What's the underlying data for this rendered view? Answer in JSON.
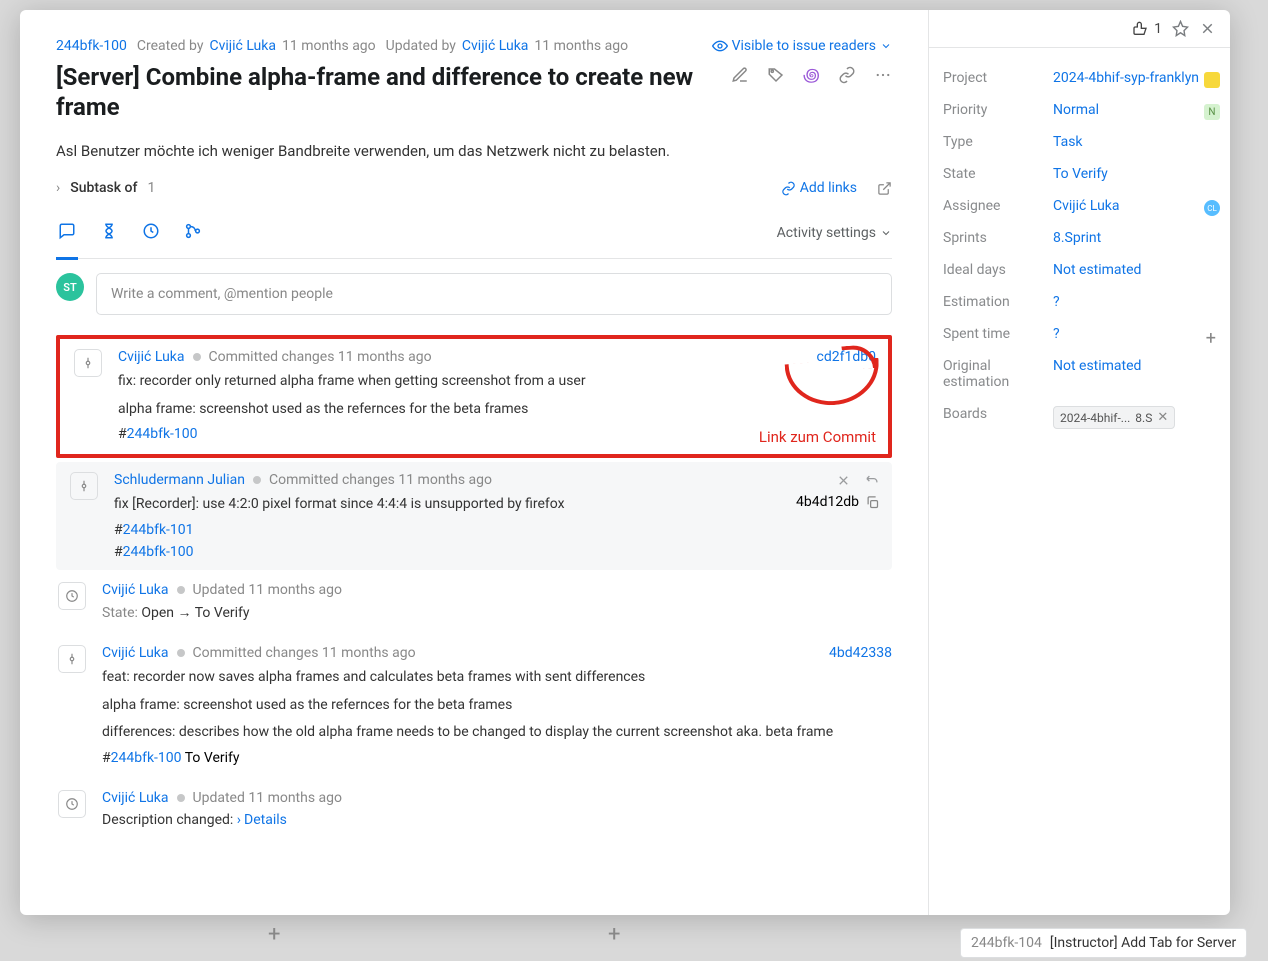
{
  "breadcrumb": {
    "issueId": "244bfk-100",
    "created": "Created by",
    "creator": "Cvijić Luka",
    "createdTime": "11 months ago",
    "updated": "Updated by",
    "updater": "Cvijić Luka",
    "updatedTime": "11 months ago",
    "visibility": "Visible to issue readers"
  },
  "title": "[Server] Combine alpha-frame and difference to create new frame",
  "description": "Asl Benutzer möchte ich weniger Bandbreite verwenden, um das Netzwerk nicht zu belasten.",
  "subtask": {
    "label": "Subtask of",
    "count": "1"
  },
  "addLinks": "Add links",
  "activitySettings": "Activity settings",
  "commentPlaceholder": "Write a comment, @mention people",
  "meAvatar": "ST",
  "annotation": "Link zum Commit",
  "voteCount": "1",
  "activities": [
    {
      "type": "commit",
      "authorText": "Cvijić Luka",
      "meta": "Committed changes 11 months ago",
      "commit": "cd2f1db0",
      "msgs": [
        "fix: recorder only returned alpha frame when getting screenshot from a user",
        "alpha frame: screenshot used as the refernces for the beta frames"
      ],
      "tags": [
        "244bfk-100"
      ]
    },
    {
      "type": "commit",
      "authorText": "Schludermann Julian",
      "meta": "Committed changes 11 months ago",
      "commit": "4b4d12db",
      "msgs": [
        "fix [Recorder]: use 4:2:0 pixel format since 4:4:4 is unsupported by firefox"
      ],
      "tags": [
        "244bfk-101",
        "244bfk-100"
      ],
      "hover": true
    },
    {
      "type": "state",
      "authorText": "Cvijić Luka",
      "meta": "Updated 11 months ago",
      "stateFrom": "Open",
      "stateTo": "To Verify"
    },
    {
      "type": "commit",
      "authorText": "Cvijić Luka",
      "meta": "Committed changes 11 months ago",
      "commit": "4bd42338",
      "msgs": [
        "feat: recorder now saves alpha frames and calculates beta frames with sent differences",
        "alpha frame: screenshot used as the refernces for the beta frames",
        "differences: describes how the old alpha frame needs to be changed to display the current screenshot aka. beta frame"
      ],
      "tags": [
        "244bfk-100"
      ],
      "suffix": "To Verify"
    },
    {
      "type": "desc",
      "authorText": "Cvijić Luka",
      "meta": "Updated 11 months ago",
      "descLabel": "Description changed:",
      "detailsLabel": "Details"
    }
  ],
  "side": {
    "fields": {
      "projectLabel": "Project",
      "projectVal": "2024-4bhif-syp-franklyn",
      "priorityLabel": "Priority",
      "priorityVal": "Normal",
      "typeLabel": "Type",
      "typeVal": "Task",
      "stateLabel": "State",
      "stateVal": "To Verify",
      "assigneeLabel": "Assignee",
      "assigneeVal": "Cvijić Luka",
      "sprintsLabel": "Sprints",
      "sprintsVal": "8.Sprint",
      "idealLabel": "Ideal days",
      "idealVal": "Not estimated",
      "estimationLabel": "Estimation",
      "estimationVal": "?",
      "spentLabel": "Spent time",
      "spentVal": "?",
      "origLabel": "Original estimation",
      "origVal": "Not estimated",
      "boardsLabel": "Boards",
      "boardChip": "2024-4bhif-...",
      "boardChipExtra": "8.S"
    }
  },
  "bgTask": {
    "id": "244bfk-104",
    "title": "[Instructor] Add Tab for Server"
  }
}
